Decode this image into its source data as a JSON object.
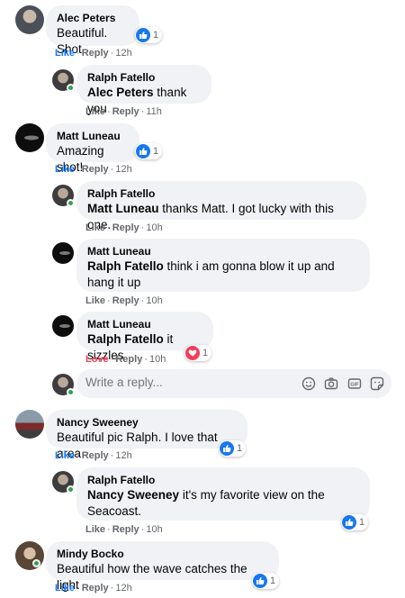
{
  "comments": [
    {
      "author": "Alec Peters",
      "text": "Beautiful. Shot",
      "reactions": "1",
      "like": "Like",
      "reply": "Reply",
      "time": "12h"
    },
    {
      "author": "Ralph Fatello",
      "tag": "Alec Peters",
      "text": " thank you",
      "like": "Like",
      "reply": "Reply",
      "time": "11h"
    },
    {
      "author": "Matt Luneau",
      "text": "Amazing shot!",
      "reactions": "1",
      "like": "Like",
      "reply": "Reply",
      "time": "12h"
    },
    {
      "author": "Ralph Fatello",
      "tag": "Matt Luneau",
      "text": " thanks Matt. I got lucky with this one.",
      "like": "Like",
      "reply": "Reply",
      "time": "10h"
    },
    {
      "author": "Matt Luneau",
      "tag": "Ralph Fatello",
      "text": " think i am gonna blow it up and hang it up",
      "like": "Like",
      "reply": "Reply",
      "time": "10h"
    },
    {
      "author": "Matt Luneau",
      "tag": "Ralph Fatello",
      "text": " it sizzles",
      "reactions": "1",
      "like": "Love",
      "reply": "Reply",
      "time": "10h"
    },
    {
      "author": "Nancy Sweeney",
      "text": "Beautiful pic Ralph. I love that area",
      "reactions": "1",
      "like": "Like",
      "reply": "Reply",
      "time": "12h"
    },
    {
      "author": "Ralph Fatello",
      "tag": "Nancy Sweeney",
      "text": " it's my favorite view on the Seacoast.",
      "reactions": "1",
      "like": "Like",
      "reply": "Reply",
      "time": "10h"
    },
    {
      "author": "Mindy Bocko",
      "text": "Beautiful how the wave catches the light",
      "reactions": "1",
      "like": "Like",
      "reply": "Reply",
      "time": "12h"
    }
  ],
  "reply_box": {
    "placeholder": "Write a reply..."
  },
  "icons": [
    "like-reaction-icon",
    "love-reaction-icon",
    "emoji-icon",
    "camera-icon",
    "gif-icon",
    "sticker-icon"
  ],
  "colors": {
    "bubble": "#f0f2f5",
    "blue": "#1876f2",
    "love": "#f33e58",
    "muted": "#65676b"
  }
}
